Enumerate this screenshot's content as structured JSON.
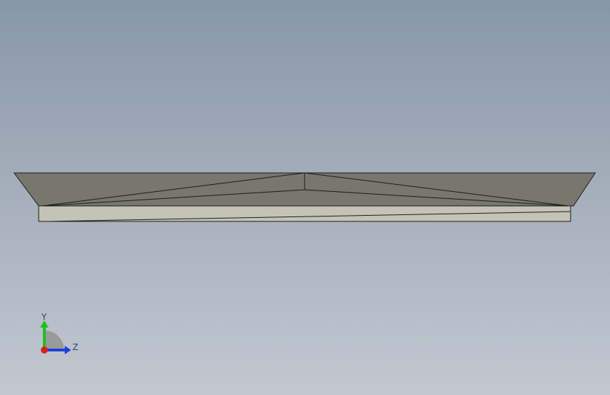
{
  "viewport": {
    "background_top": "#8797aa",
    "background_bottom": "#c2c8d0"
  },
  "model": {
    "face_color": "#77776d",
    "edge_color": "#1a1a1a",
    "base_color": "#c4c4b6"
  },
  "triad": {
    "y_label": "Y",
    "z_label": "Z",
    "y_color": "#1fbf1f",
    "z_color": "#1f3fd8",
    "x_color": "#d81f1f"
  }
}
